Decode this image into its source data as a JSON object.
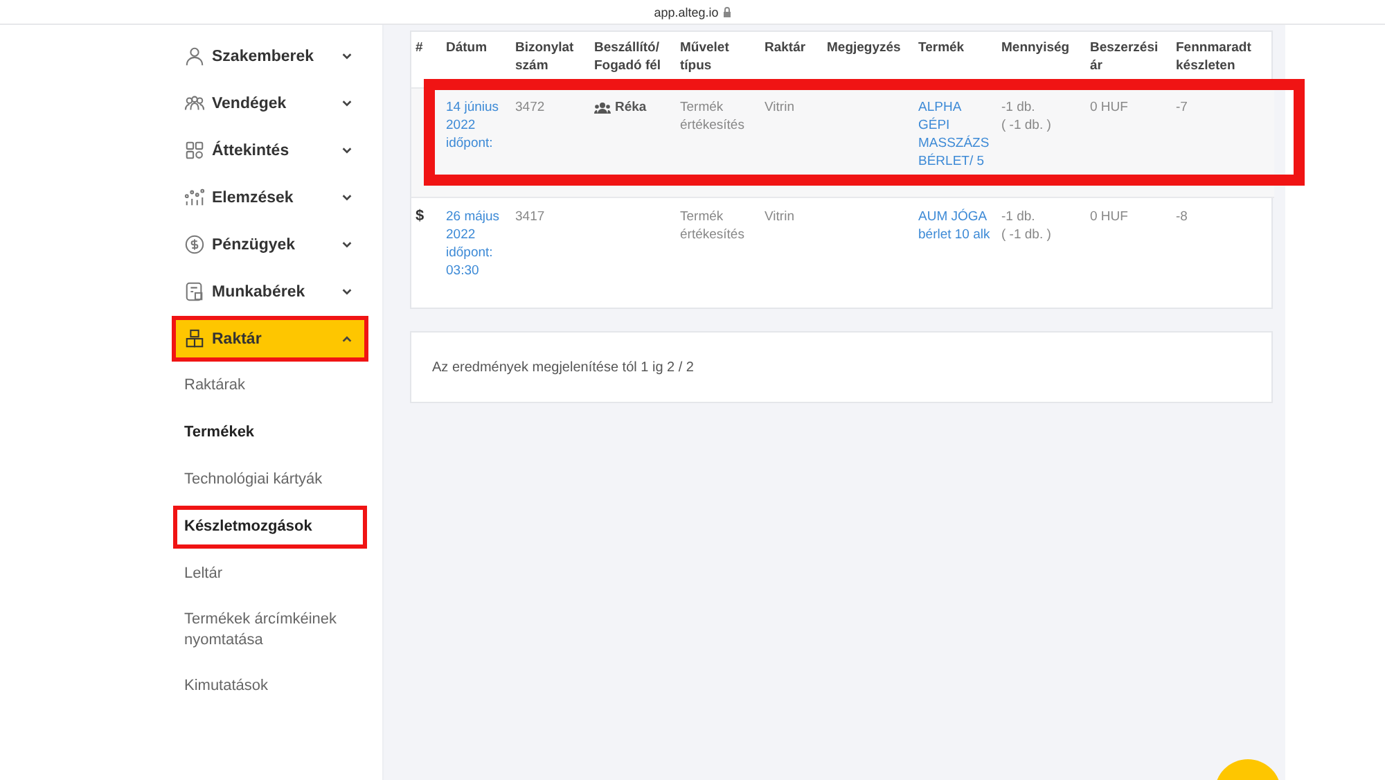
{
  "browser": {
    "address": "app.alteg.io"
  },
  "sidebar": {
    "items": [
      {
        "label": "Szakemberek",
        "expanded": false,
        "selected": false
      },
      {
        "label": "Vendégek",
        "expanded": false,
        "selected": false
      },
      {
        "label": "Áttekintés",
        "expanded": false,
        "selected": false
      },
      {
        "label": "Elemzések",
        "expanded": false,
        "selected": false
      },
      {
        "label": "Pénzügyek",
        "expanded": false,
        "selected": false
      },
      {
        "label": "Munkabérek",
        "expanded": false,
        "selected": false
      },
      {
        "label": "Raktár",
        "expanded": true,
        "selected": true,
        "children": [
          {
            "label": "Raktárak",
            "selected": false,
            "bold": false
          },
          {
            "label": "Termékek",
            "selected": false,
            "bold": true
          },
          {
            "label": "Technológiai kártyák",
            "selected": false,
            "bold": false
          },
          {
            "label": "Készletmozgások",
            "selected": true,
            "bold": true
          },
          {
            "label": "Leltár",
            "selected": false,
            "bold": false
          },
          {
            "label": "Termékek árcímkéinek nyomtatása",
            "selected": false,
            "bold": false
          },
          {
            "label": "Kimutatások",
            "selected": false,
            "bold": false
          }
        ]
      }
    ]
  },
  "table": {
    "columns": [
      "#",
      "Dátum",
      "Bizonylat szám",
      "Beszállító/ Fogadó fél",
      "Művelet típus",
      "Raktár",
      "Megjegyzés",
      "Termék",
      "Mennyiség",
      "Beszerzési ár",
      "Fennmaradt készleten"
    ],
    "rows": [
      {
        "highlighted": true,
        "mark": "",
        "date": "14 június 2022 időpont:",
        "doc_number": "3472",
        "partner": "Réka",
        "operation": "Termék értékesítés",
        "warehouse": "Vitrin",
        "product": "ALPHA GÉPI MASSZÁZS BÉRLET/ 5",
        "quantity": "-1 db.",
        "quantity_detail": "( -1 db. )",
        "price": "0 HUF",
        "remaining": "-7"
      },
      {
        "highlighted": false,
        "mark": "$",
        "date": "26 május 2022 időpont: 03:30",
        "doc_number": "3417",
        "partner": "",
        "operation": "Termék értékesítés",
        "warehouse": "Vitrin",
        "product": "AUM JÓGA bérlet 10 alk",
        "quantity": "-1 db.",
        "quantity_detail": "( -1 db. )",
        "price": "0 HUF",
        "remaining": "-8"
      }
    ]
  },
  "pagination": {
    "summary": "Az eredmények megjelenítése tól 1 ig 2 / 2"
  }
}
